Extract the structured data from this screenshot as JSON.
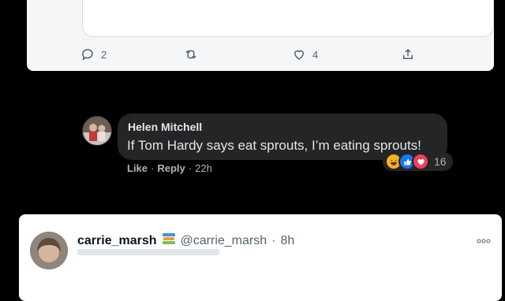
{
  "top_tweet": {
    "reply_count": "2",
    "like_count": "4"
  },
  "comment": {
    "author": "Helen Mitchell",
    "text": "If Tom Hardy says eat sprouts, I’m eating sprouts!",
    "like_label": "Like",
    "separator": "·",
    "reply_label": "Reply",
    "time": "22h",
    "reaction_count": "16",
    "reactions": [
      "haha",
      "like",
      "love"
    ]
  },
  "bottom_tweet": {
    "name": "carrie_marsh",
    "handle": "@carrie_marsh",
    "separator": "·",
    "time": "8h"
  },
  "colors": {
    "bubble": "#242526",
    "like_blue": "#1877f2",
    "love_red": "#f33e58",
    "haha_yellow": "#f7b125"
  }
}
